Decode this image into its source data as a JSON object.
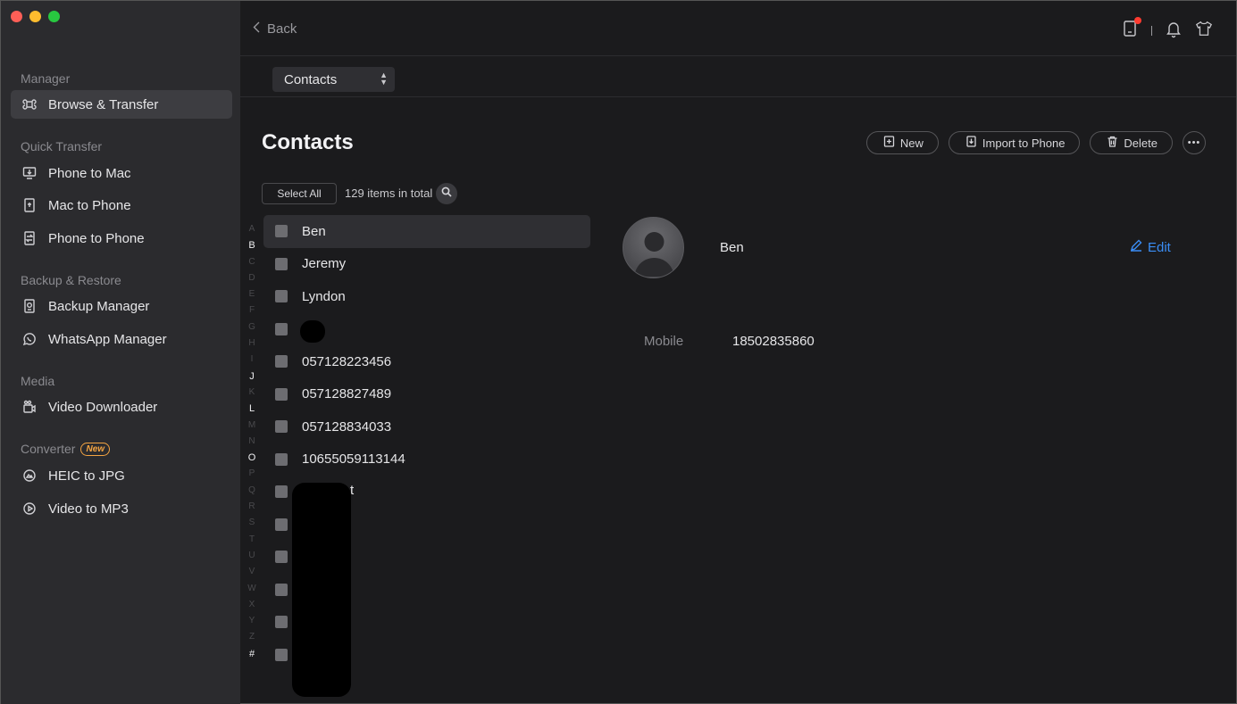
{
  "sidebar": {
    "sections": [
      {
        "title": "Manager",
        "items": [
          {
            "label": "Browse & Transfer",
            "icon": "command-icon"
          }
        ]
      },
      {
        "title": "Quick Transfer",
        "items": [
          {
            "label": "Phone to Mac",
            "icon": "monitor-download-icon"
          },
          {
            "label": "Mac to Phone",
            "icon": "phone-upload-icon"
          },
          {
            "label": "Phone to Phone",
            "icon": "phone-transfer-icon"
          }
        ]
      },
      {
        "title": "Backup & Restore",
        "items": [
          {
            "label": "Backup Manager",
            "icon": "backup-icon"
          },
          {
            "label": "WhatsApp Manager",
            "icon": "whatsapp-icon"
          }
        ]
      },
      {
        "title": "Media",
        "items": [
          {
            "label": "Video Downloader",
            "icon": "video-camera-icon"
          }
        ]
      },
      {
        "title": "Converter",
        "badge": "New",
        "items": [
          {
            "label": "HEIC to JPG",
            "icon": "image-convert-icon"
          },
          {
            "label": "Video to MP3",
            "icon": "audio-convert-icon"
          }
        ]
      }
    ]
  },
  "topbar": {
    "back_label": "Back"
  },
  "selector": {
    "value": "Contacts"
  },
  "page": {
    "title": "Contacts"
  },
  "actions": {
    "new": "New",
    "import": "Import to Phone",
    "delete": "Delete"
  },
  "list_controls": {
    "select_all": "Select All",
    "count": "129 items in total"
  },
  "alphabet": [
    "A",
    "B",
    "C",
    "D",
    "E",
    "F",
    "G",
    "H",
    "I",
    "J",
    "K",
    "L",
    "M",
    "N",
    "O",
    "P",
    "Q",
    "R",
    "S",
    "T",
    "U",
    "V",
    "W",
    "X",
    "Y",
    "Z",
    "#"
  ],
  "alphabet_active": [
    "B",
    "J",
    "L",
    "O",
    "#"
  ],
  "contacts": [
    "Ben",
    "Jeremy",
    "Lyndon",
    "",
    "057128223456",
    "057128827489",
    "057128834033",
    "10655059113144",
    "",
    "",
    "",
    "",
    "",
    ""
  ],
  "contact_fragments": [
    "t"
  ],
  "detail": {
    "name": "Ben",
    "edit_label": "Edit",
    "fields": [
      {
        "label": "Mobile",
        "value": "18502835860"
      }
    ]
  },
  "colors": {
    "accent": "#3a8df5",
    "badge": "#f4a442",
    "notify": "#ff3b30"
  }
}
